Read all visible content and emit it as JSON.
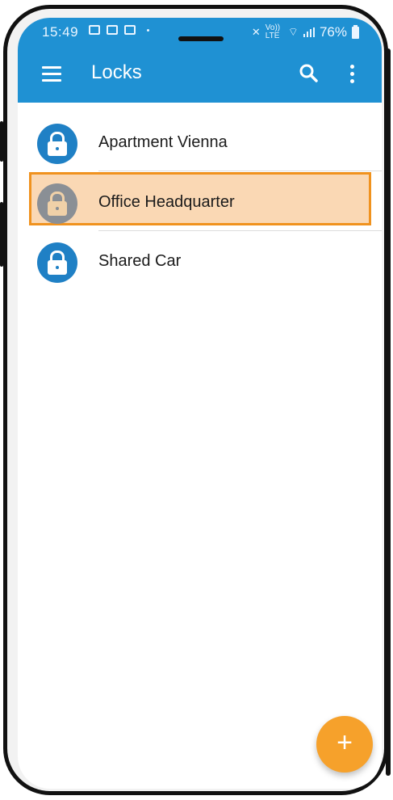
{
  "status_bar": {
    "time": "15:49",
    "volte": "Vo)) LTE",
    "battery": "76%"
  },
  "app": {
    "title": "Locks"
  },
  "icons": {
    "menu": "hamburger-menu-icon",
    "search": "search-icon",
    "more": "more-vert-icon",
    "lock": "lock-icon",
    "add": "plus-icon"
  },
  "locks": [
    {
      "name": "Apartment Vienna",
      "state": "active"
    },
    {
      "name": "Office Headquarter",
      "state": "inactive"
    },
    {
      "name": "Shared Car",
      "state": "active"
    }
  ],
  "fab": {
    "label": "+"
  },
  "colors": {
    "primary": "#1f91d3",
    "lock_active": "#1f80c5",
    "lock_inactive": "#8a8f95",
    "highlight_fill": "#fad8b4",
    "highlight_border": "#f0921e",
    "fab": "#f6a12b"
  }
}
